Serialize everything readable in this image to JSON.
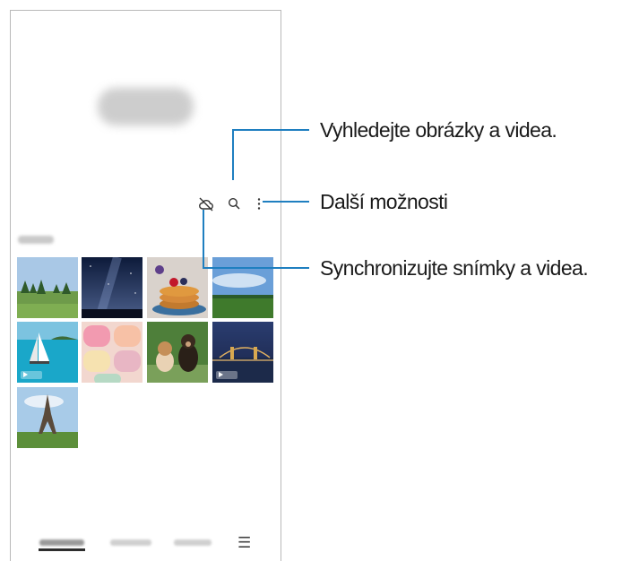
{
  "callouts": {
    "search": "Vyhledejte obrázky a videa.",
    "more_options": "Další možnosti",
    "sync": "Synchronizujte snímky a videa."
  },
  "icons": {
    "cloud_sync": "cloud-off-icon",
    "search": "search-icon",
    "more": "more-options-icon",
    "menu": "menu-icon"
  },
  "nav": {
    "menu_glyph": "☰"
  },
  "thumbnails": [
    {
      "subject": "landscape-trees",
      "video": false
    },
    {
      "subject": "night-sky",
      "video": false
    },
    {
      "subject": "pancakes",
      "video": false
    },
    {
      "subject": "field-sky",
      "video": false
    },
    {
      "subject": "sailboat-sea",
      "video": true
    },
    {
      "subject": "macarons",
      "video": false
    },
    {
      "subject": "dogs",
      "video": false
    },
    {
      "subject": "city-bridge-night",
      "video": true
    },
    {
      "subject": "eiffel-tower",
      "video": false
    }
  ],
  "colors": {
    "accent": "#1f7fc0"
  }
}
